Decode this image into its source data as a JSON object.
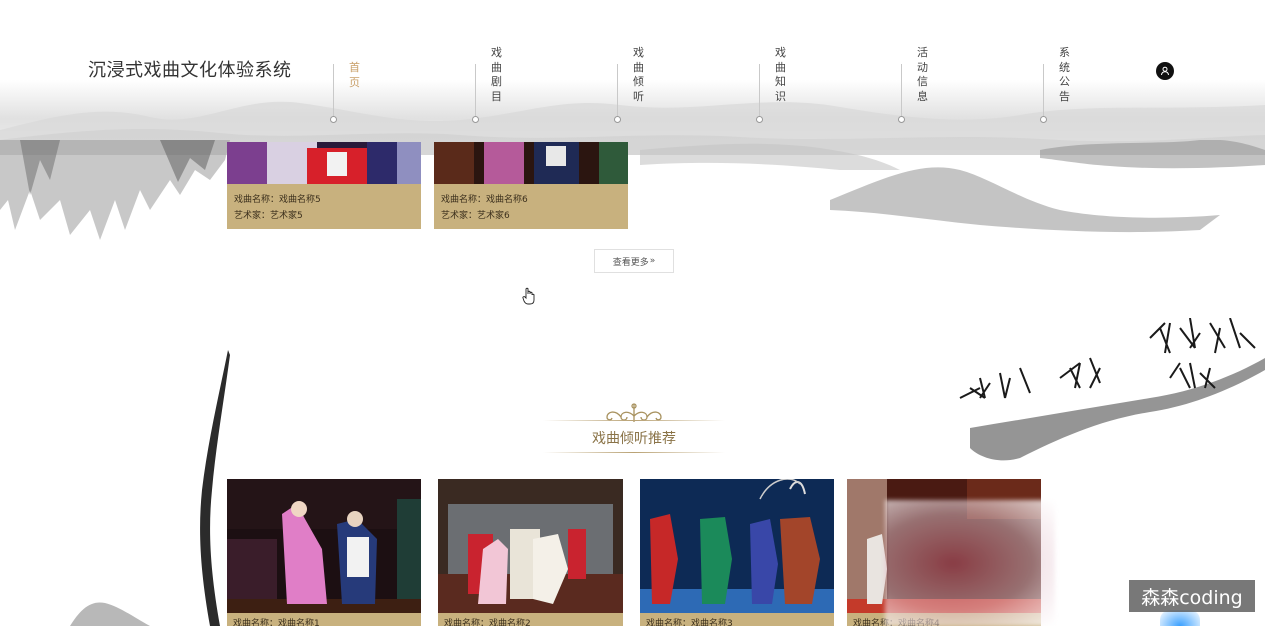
{
  "header": {
    "site_title": "沉浸式戏曲文化体验系统",
    "nav": [
      {
        "label": "首页",
        "active": true
      },
      {
        "label": "戏曲剧目",
        "active": false
      },
      {
        "label": "戏曲倾听",
        "active": false
      },
      {
        "label": "戏曲知识",
        "active": false
      },
      {
        "label": "活动信息",
        "active": false
      },
      {
        "label": "系统公告",
        "active": false
      }
    ],
    "user_icon": "user-icon"
  },
  "opera_list": {
    "cards": [
      {
        "name_line": "戏曲名称：戏曲名称5",
        "artist_line": "艺术家：艺术家5"
      },
      {
        "name_line": "戏曲名称：戏曲名称6",
        "artist_line": "艺术家：艺术家6"
      }
    ],
    "more_button": "查看更多",
    "more_icon": "»"
  },
  "listen_section": {
    "title": "戏曲倾听推荐",
    "cards": [
      {
        "caption": "戏曲名称：戏曲名称1"
      },
      {
        "caption": "戏曲名称：戏曲名称2"
      },
      {
        "caption": "戏曲名称：戏曲名称3"
      },
      {
        "caption": "戏曲名称：戏曲名称4"
      }
    ]
  },
  "watermark": "森森coding",
  "colors": {
    "accent_gold": "#c8b17e",
    "title_gold": "#8a7347",
    "nav_active": "#c9a06a"
  }
}
